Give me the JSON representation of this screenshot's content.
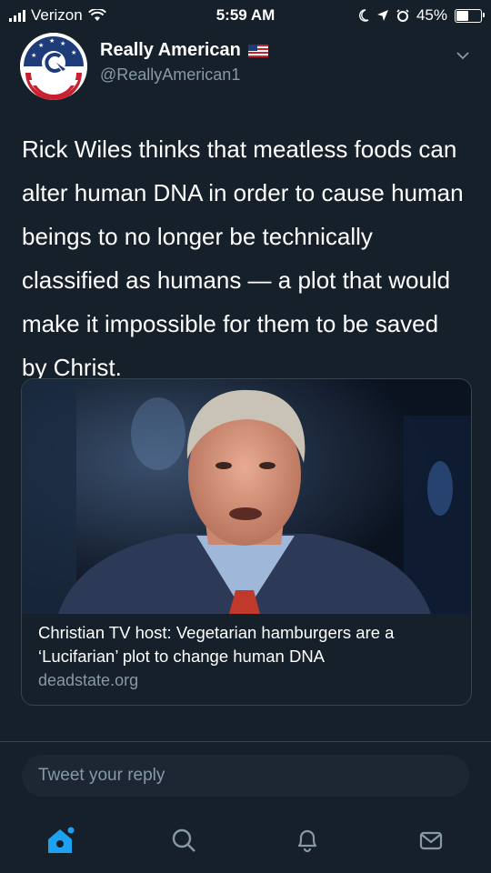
{
  "status_bar": {
    "carrier": "Verizon",
    "time": "5:59 AM",
    "battery": "45%",
    "battery_level": 0.45
  },
  "tweet": {
    "author_name": "Really American",
    "author_handle": "@ReallyAmerican1",
    "text": "Rick Wiles thinks that meatless foods can alter human DNA in order to cause human beings to no longer be technically classified as humans — a plot that would make it impossible for them to be saved by Christ.",
    "card": {
      "title": "Christian TV host: Vegetarian hamburgers are a ‘Lucifarian’ plot to change human DNA",
      "domain": "deadstate.org"
    }
  },
  "reply": {
    "placeholder": "Tweet your reply"
  },
  "tabs": [
    "home-icon",
    "search-icon",
    "notifications-icon",
    "messages-icon"
  ],
  "colors": {
    "background": "#15202b",
    "accent": "#1da1f2",
    "secondary_text": "#8899a6",
    "border": "#38444d"
  }
}
